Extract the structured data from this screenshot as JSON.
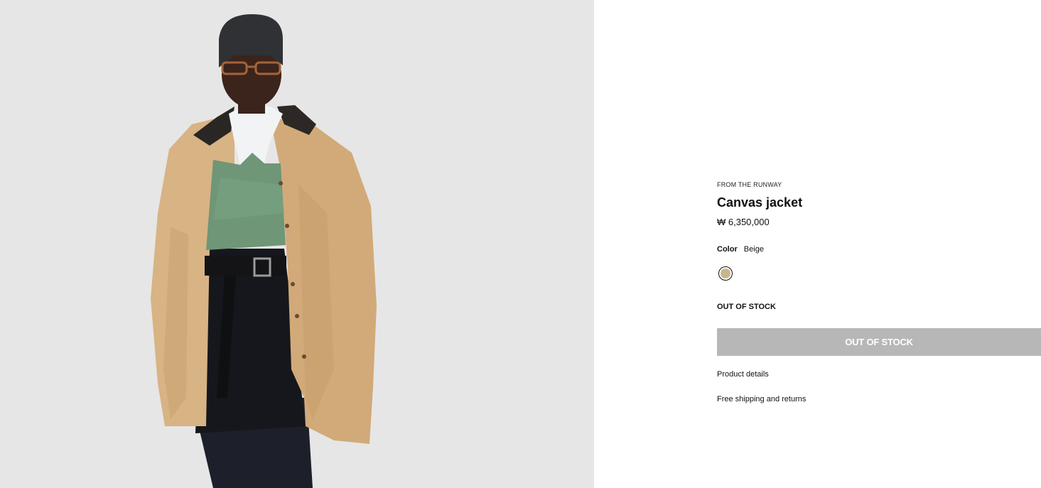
{
  "product": {
    "eyebrow": "FROM THE RUNWAY",
    "name": "Canvas jacket",
    "price": "₩ 6,350,000",
    "color_label": "Color",
    "color_value": "Beige",
    "stock_status": "OUT OF STOCK",
    "button_label": "OUT OF STOCK",
    "product_details_label": "Product details",
    "shipping_label": "Free shipping and returns"
  },
  "colors": {
    "swatch": "#c8b68c",
    "button_bg": "#b7b7b7",
    "gallery_bg": "#e6e6e6"
  },
  "image": {
    "subject": "model-wearing-canvas-jacket"
  }
}
